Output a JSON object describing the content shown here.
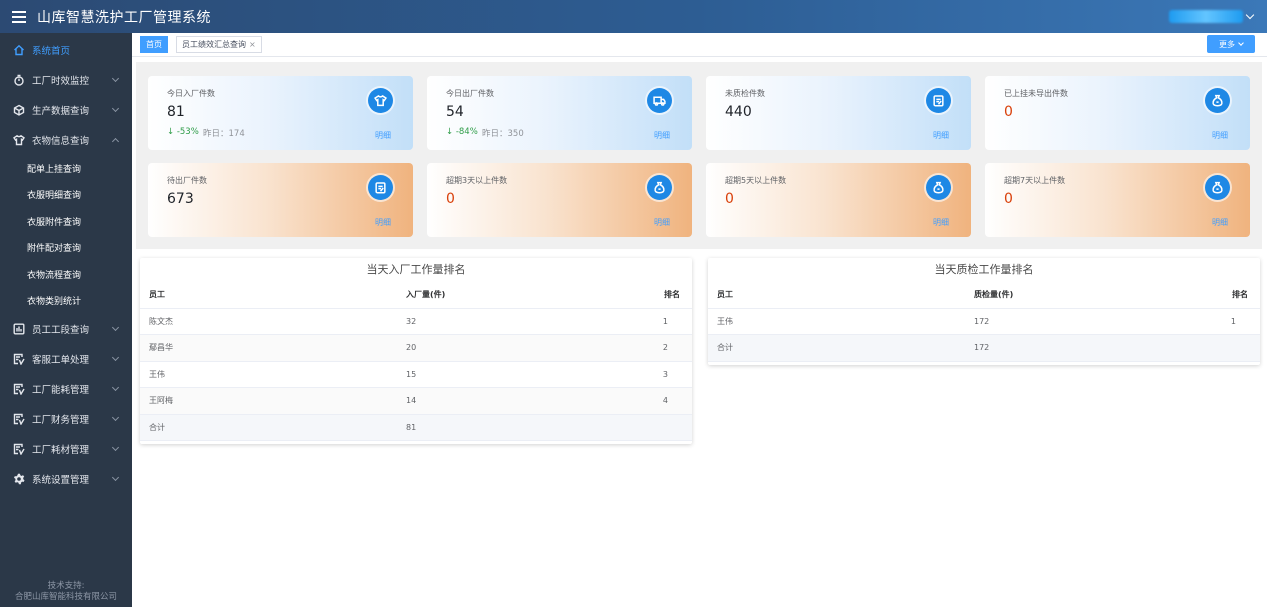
{
  "app": {
    "title": "山库智慧洗护工厂管理系统"
  },
  "sidebar": {
    "home": "系统首页",
    "items": [
      {
        "label": "工厂时效监控"
      },
      {
        "label": "生产数据查询"
      },
      {
        "label": "衣物信息查询"
      }
    ],
    "sub_items": [
      "配单上挂查询",
      "衣服明细查询",
      "衣服附件查询",
      "附件配对查询",
      "衣物流程查询",
      "衣物类别统计"
    ],
    "items2": [
      {
        "label": "员工工段查询"
      },
      {
        "label": "客服工单处理"
      },
      {
        "label": "工厂能耗管理"
      },
      {
        "label": "工厂财务管理"
      },
      {
        "label": "工厂耗材管理"
      },
      {
        "label": "系统设置管理"
      }
    ],
    "support_line1": "技术支持:",
    "support_line2": "合肥山库智能科技有限公司"
  },
  "tabs": {
    "home": "首页",
    "perf": "员工绩效汇总查询",
    "close": "×",
    "more": "更多"
  },
  "stats": {
    "detail_label": "明细",
    "cards": [
      {
        "label": "今日入厂件数",
        "value": "81",
        "delta": "↓ -53%",
        "yesterday": "昨日：174",
        "icon": "shirt-icon"
      },
      {
        "label": "今日出厂件数",
        "value": "54",
        "delta": "↓ -84%",
        "yesterday": "昨日：350",
        "icon": "truck-icon"
      },
      {
        "label": "未质检件数",
        "value": "440",
        "icon": "clipboard-icon"
      },
      {
        "label": "已上挂未导出件数",
        "value": "0",
        "icon": "bag-icon"
      },
      {
        "label": "待出厂件数",
        "value": "673",
        "icon": "clipboard-icon"
      },
      {
        "label": "超期3天以上件数",
        "value": "0",
        "icon": "bag-icon"
      },
      {
        "label": "超期5天以上件数",
        "value": "0",
        "icon": "bag-icon"
      },
      {
        "label": "超期7天以上件数",
        "value": "0",
        "icon": "bag-icon"
      }
    ]
  },
  "inbound_rank": {
    "title": "当天入厂工作量排名",
    "headers": {
      "employee": "员工",
      "qty": "入厂量(件)",
      "rank": "排名"
    },
    "rows": [
      {
        "employee": "陈文杰",
        "qty": "32",
        "rank": "1"
      },
      {
        "employee": "鄢昌华",
        "qty": "20",
        "rank": "2"
      },
      {
        "employee": "王伟",
        "qty": "15",
        "rank": "3"
      },
      {
        "employee": "王阿梅",
        "qty": "14",
        "rank": "4"
      }
    ],
    "total": {
      "label": "合计",
      "qty": "81"
    }
  },
  "qc_rank": {
    "title": "当天质检工作量排名",
    "headers": {
      "employee": "员工",
      "qty": "质检量(件)",
      "rank": "排名"
    },
    "rows": [
      {
        "employee": "王伟",
        "qty": "172",
        "rank": "1"
      }
    ],
    "total": {
      "label": "合计",
      "qty": "172"
    }
  }
}
